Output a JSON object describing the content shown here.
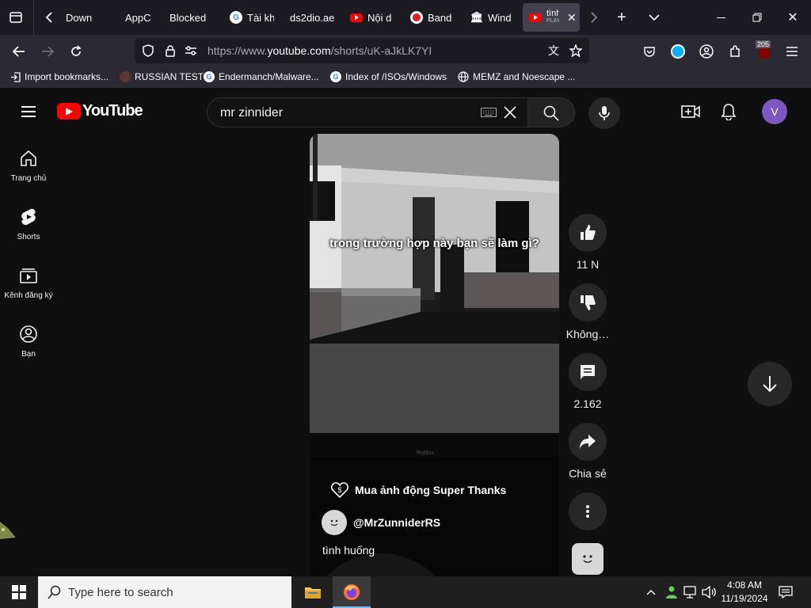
{
  "browser": {
    "tabs": [
      {
        "label": "Down",
        "favicon": "",
        "active": false
      },
      {
        "label": "AppC",
        "favicon": "",
        "active": false
      },
      {
        "label": "Blocked",
        "favicon": "",
        "active": false
      },
      {
        "label": "Tài kh",
        "favicon": "google-icon",
        "active": false
      },
      {
        "label": "ds2dio.ae",
        "favicon": "",
        "active": false
      },
      {
        "label": "Nội d",
        "favicon": "youtube-icon",
        "active": false
      },
      {
        "label": "Band",
        "favicon": "record-icon",
        "active": false
      },
      {
        "label": "Wind",
        "favicon": "museum-icon",
        "active": false
      },
      {
        "label": "tình",
        "sublabel": "PLAY",
        "favicon": "youtube-icon",
        "active": true
      }
    ],
    "url_prefix": "https://www.",
    "url_main": "youtube.com",
    "url_path": "/shorts/uK-aJkLK7YI",
    "badge_count": "205",
    "bookmarks": [
      {
        "label": "Import bookmarks...",
        "icon": "import-icon"
      },
      {
        "label": "RUSSIAN TEST",
        "icon": "profile-icon"
      },
      {
        "label": "Endermanch/Malware...",
        "icon": "google-icon"
      },
      {
        "label": "Index of /ISOs/Windows",
        "icon": "google-icon"
      },
      {
        "label": "MEMZ and Noescape ...",
        "icon": "globe-icon"
      }
    ]
  },
  "youtube": {
    "logo_text": "YouTube",
    "search_value": "mr zinnider",
    "avatar_letter": "V",
    "sidebar": [
      {
        "label": "Trang chủ",
        "icon": "home-icon"
      },
      {
        "label": "Shorts",
        "icon": "shorts-icon"
      },
      {
        "label": "Kênh đăng ký",
        "icon": "subscriptions-icon"
      },
      {
        "label": "Bạn",
        "icon": "you-icon"
      }
    ],
    "short": {
      "caption": "trong trường hợp này bạn sẽ làm gì?",
      "watermark": "Roblox",
      "super_thanks": "Mua ảnh động Super Thanks",
      "channel": "@MrZunniderRS",
      "title": "tình huống"
    },
    "actions": {
      "likes": "11 N",
      "dislike": "Không…",
      "comments": "2.162",
      "share": "Chia sẻ"
    }
  },
  "taskbar": {
    "search_placeholder": "Type here to search",
    "time": "4:08 AM",
    "date": "11/19/2024"
  },
  "colors": {
    "youtube_red": "#ff0000",
    "accent_purple": "#7e57c2"
  }
}
